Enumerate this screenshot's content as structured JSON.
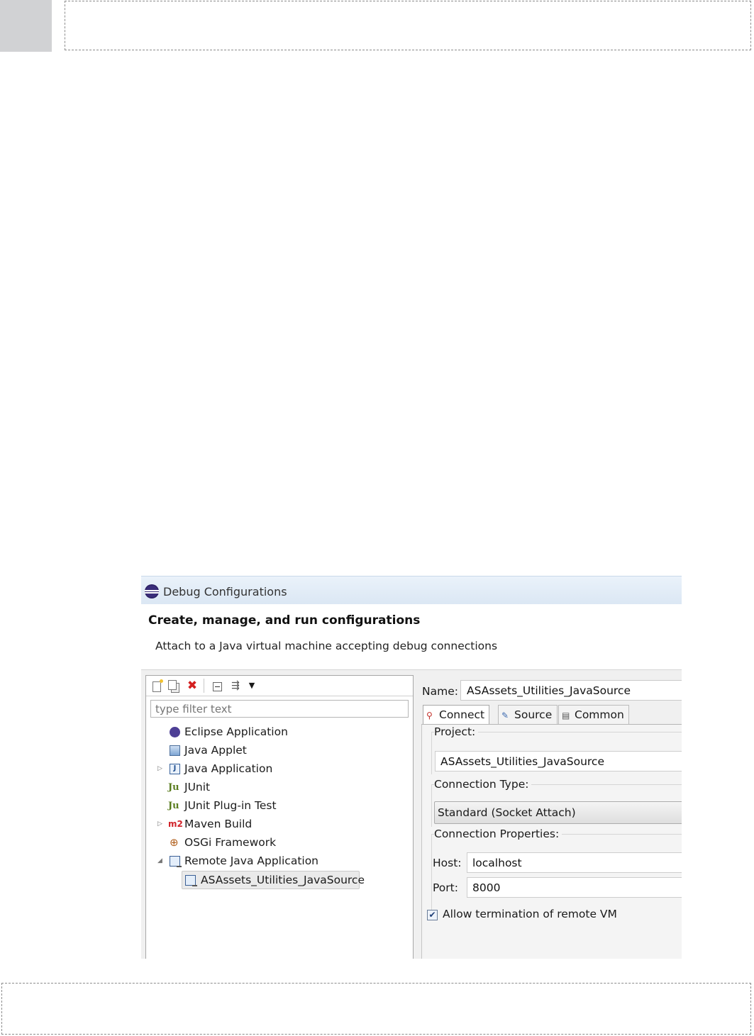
{
  "dialog": {
    "title": "Debug Configurations",
    "header_title": "Create, manage, and run configurations",
    "header_message": "Attach to a Java virtual machine accepting debug connections"
  },
  "left": {
    "filter_placeholder": "type filter text",
    "toolbar_icons": [
      "new-launch-configuration-icon",
      "duplicate-icon",
      "delete-icon",
      "collapse-all-icon",
      "filter-icon",
      "view-menu-dropdown-icon"
    ],
    "tree": [
      {
        "label": "Eclipse Application",
        "icon": "eclipse-icon",
        "expander": ""
      },
      {
        "label": "Java Applet",
        "icon": "java-applet-icon",
        "expander": ""
      },
      {
        "label": "Java Application",
        "icon": "java-application-icon",
        "expander": "▷"
      },
      {
        "label": "JUnit",
        "icon": "junit-icon",
        "expander": ""
      },
      {
        "label": "JUnit Plug-in Test",
        "icon": "junit-plugin-icon",
        "expander": ""
      },
      {
        "label": "Maven Build",
        "icon": "maven-icon",
        "expander": "▷"
      },
      {
        "label": "OSGi Framework",
        "icon": "osgi-icon",
        "expander": ""
      },
      {
        "label": "Remote Java Application",
        "icon": "remote-java-icon",
        "expander": "◢"
      },
      {
        "label": "ASAssets_Utilities_JavaSource",
        "icon": "remote-java-config-icon",
        "expander": ""
      }
    ]
  },
  "right": {
    "name_label": "Name:",
    "name_value": "ASAssets_Utilities_JavaSource",
    "tabs": [
      {
        "label": "Connect",
        "icon": "connect-icon",
        "active": true
      },
      {
        "label": "Source",
        "icon": "source-icon",
        "active": false
      },
      {
        "label": "Common",
        "icon": "common-icon",
        "active": false
      }
    ],
    "project_label": "Project:",
    "project_value": "ASAssets_Utilities_JavaSource",
    "connection_type_label": "Connection Type:",
    "connection_type_value": "Standard (Socket Attach)",
    "connection_properties_label": "Connection Properties:",
    "host_label": "Host:",
    "host_value": "localhost",
    "port_label": "Port:",
    "port_value": "8000",
    "allow_termination_label": "Allow termination of remote VM",
    "allow_termination_checked": true
  }
}
